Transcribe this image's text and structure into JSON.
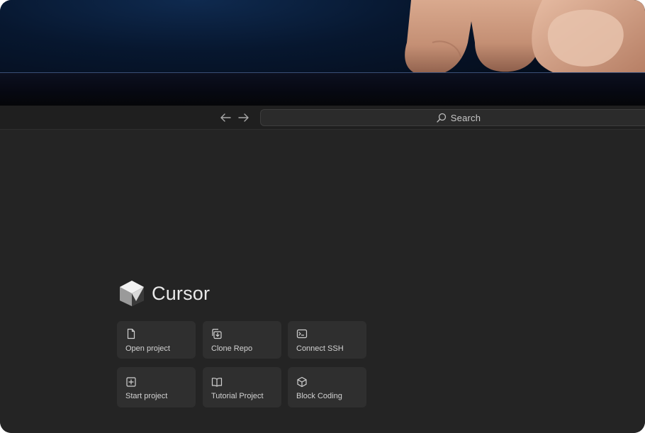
{
  "titlebar": {
    "search": {
      "label": "Search",
      "icon": "search-icon"
    },
    "nav": {
      "back_icon": "arrow-left-icon",
      "forward_icon": "arrow-right-icon"
    }
  },
  "brand": {
    "name": "Cursor",
    "logo_icon": "cursor-cube-logo"
  },
  "actions": [
    {
      "label": "Open project",
      "icon": "file-icon"
    },
    {
      "label": "Clone Repo",
      "icon": "clone-download-icon"
    },
    {
      "label": "Connect SSH",
      "icon": "terminal-icon"
    },
    {
      "label": "Start project",
      "icon": "plus-square-icon"
    },
    {
      "label": "Tutorial Project",
      "icon": "book-open-icon"
    },
    {
      "label": "Block Coding",
      "icon": "cube-icon"
    }
  ],
  "colors": {
    "background": "#242424",
    "tile": "#2f2f2f",
    "titlebar": "#1f1f1f",
    "text": "#d2d2d2"
  }
}
